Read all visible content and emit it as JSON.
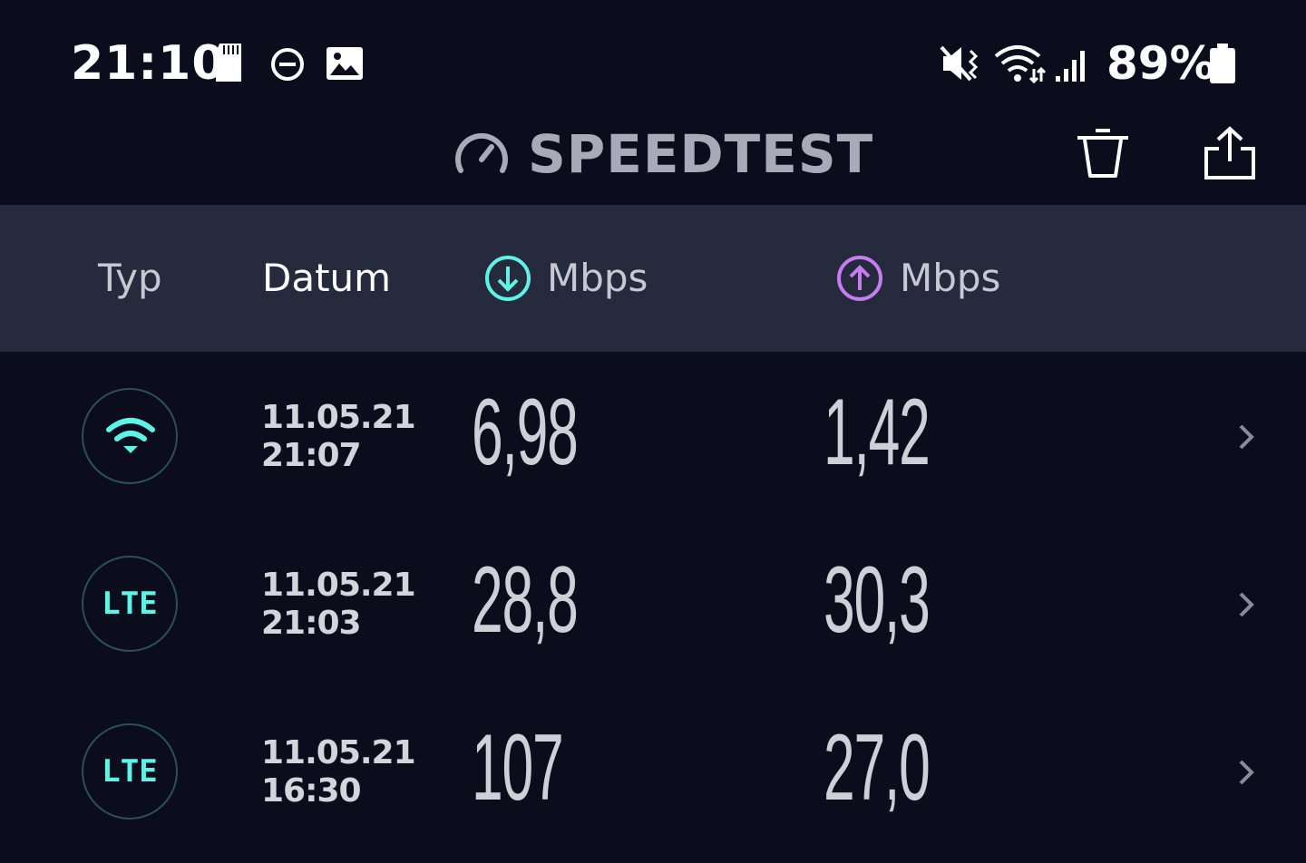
{
  "status_bar": {
    "time": "21:10",
    "battery_percent": "89%",
    "left_icons": [
      "sd-card-icon",
      "do-not-disturb-icon",
      "image-icon"
    ],
    "right_icons": [
      "mute-vibrate-icon",
      "wifi-icon",
      "cellular-signal-icon",
      "battery-icon"
    ]
  },
  "app_bar": {
    "title": "SPEEDTEST",
    "icons": [
      "speedometer-icon",
      "trash-icon",
      "share-icon"
    ]
  },
  "table": {
    "headers": {
      "type": "Typ",
      "date": "Datum",
      "download": "Mbps",
      "upload": "Mbps"
    },
    "rows": [
      {
        "type": "wifi",
        "type_label": "",
        "date": "11.05.21",
        "time": "21:07",
        "download": "6,98",
        "upload": "1,42"
      },
      {
        "type": "lte",
        "type_label": "LTE",
        "date": "11.05.21",
        "time": "21:03",
        "download": "28,8",
        "upload": "30,3"
      },
      {
        "type": "lte",
        "type_label": "LTE",
        "date": "11.05.21",
        "time": "16:30",
        "download": "107",
        "upload": "27,0"
      }
    ]
  },
  "colors": {
    "background": "#0b0d1c",
    "header_bg": "#262a3d",
    "download_accent": "#5ff2e6",
    "upload_accent": "#c77cf2",
    "title_grey": "#a9aab8"
  }
}
